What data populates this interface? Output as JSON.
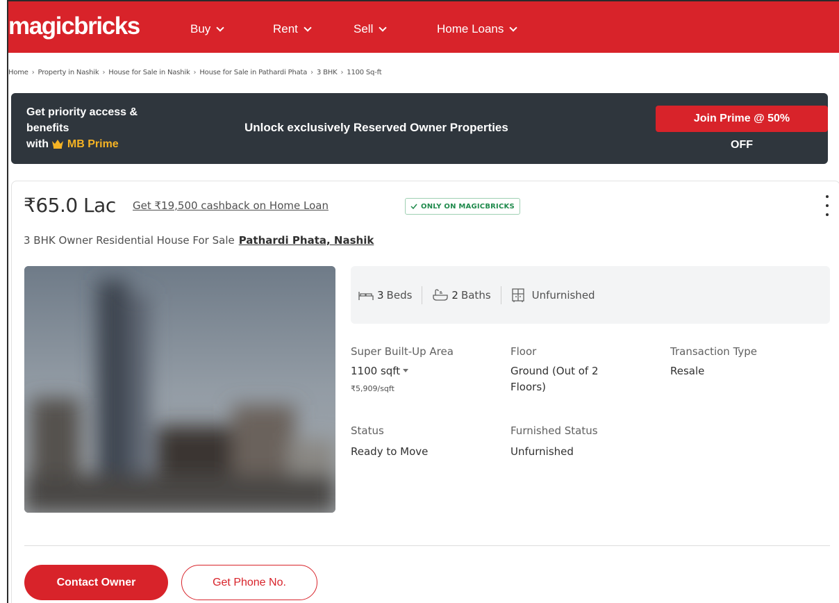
{
  "header": {
    "logo": "magicbricks",
    "nav": [
      {
        "label": "Buy"
      },
      {
        "label": "Rent"
      },
      {
        "label": "Sell"
      },
      {
        "label": "Home Loans"
      }
    ]
  },
  "breadcrumb": [
    "Home",
    "Property in Nashik",
    "House for Sale in Nashik",
    "House for Sale in Pathardi Phata",
    "3 BHK",
    "1100 Sq-ft"
  ],
  "prime": {
    "line1": "Get priority access &",
    "line2": "benefits",
    "line3_prefix": "with",
    "line3_brand": "MB Prime",
    "headline": "Unlock exclusively Reserved Owner Properties",
    "button": "Join Prime @ 50%",
    "button_suffix": "OFF"
  },
  "listing": {
    "price": "₹65.0 Lac",
    "cashback": "Get ₹19,500 cashback on Home Loan",
    "badge": "ONLY ON MAGICBRICKS",
    "title": "3 BHK Owner Residential House For Sale",
    "location": "Pathardi Phata, Nashik",
    "amenities": {
      "beds_num": "3",
      "beds_label": "Beds",
      "baths_num": "2",
      "baths_label": "Baths",
      "furnishing": "Unfurnished"
    },
    "details": {
      "area_label": "Super Built-Up Area",
      "area_value": "1100 sqft",
      "area_rate": "₹5,909/sqft",
      "floor_label": "Floor",
      "floor_value_1": "Ground (Out of 2",
      "floor_value_2": "Floors)",
      "transaction_label": "Transaction Type",
      "transaction_value": "Resale",
      "status_label": "Status",
      "status_value": "Ready to Move",
      "furnished_label": "Furnished Status",
      "furnished_value": "Unfurnished"
    },
    "actions": {
      "contact": "Contact Owner",
      "phone": "Get Phone No."
    }
  },
  "colors": {
    "brand_red": "#d8232a",
    "banner_dark": "#2f363d",
    "prime_gold": "#f5b324",
    "badge_green": "#1f8a4c"
  }
}
